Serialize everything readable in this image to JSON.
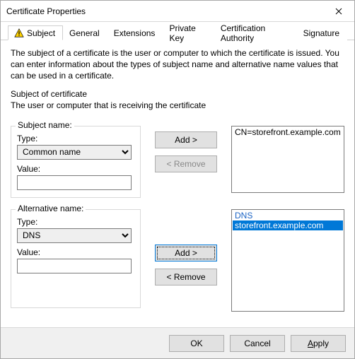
{
  "window": {
    "title": "Certificate Properties"
  },
  "tabs": {
    "subject": "Subject",
    "general": "General",
    "extensions": "Extensions",
    "private_key": "Private Key",
    "ca": "Certification Authority",
    "signature": "Signature"
  },
  "description": "The subject of a certificate is the user or computer to which the certificate is issued. You can enter information about the types of subject name and alternative name values that can be used in a certificate.",
  "section": {
    "heading": "Subject of certificate",
    "sub": "The user or computer that is receiving the certificate"
  },
  "subject_name": {
    "legend": "Subject name:",
    "type_label": "Type:",
    "type_value": "Common name",
    "value_label": "Value:",
    "value_value": "",
    "add": "Add >",
    "remove": "< Remove",
    "list": [
      "CN=storefront.example.com"
    ]
  },
  "alt_name": {
    "legend": "Alternative name:",
    "type_label": "Type:",
    "type_value": "DNS",
    "value_label": "Value:",
    "value_value": "",
    "add": "Add >",
    "remove": "< Remove",
    "list_header": "DNS",
    "list": [
      "storefront.example.com"
    ],
    "selected_index": 0
  },
  "footer": {
    "ok": "OK",
    "cancel": "Cancel",
    "apply_u": "A",
    "apply_rest": "pply"
  }
}
